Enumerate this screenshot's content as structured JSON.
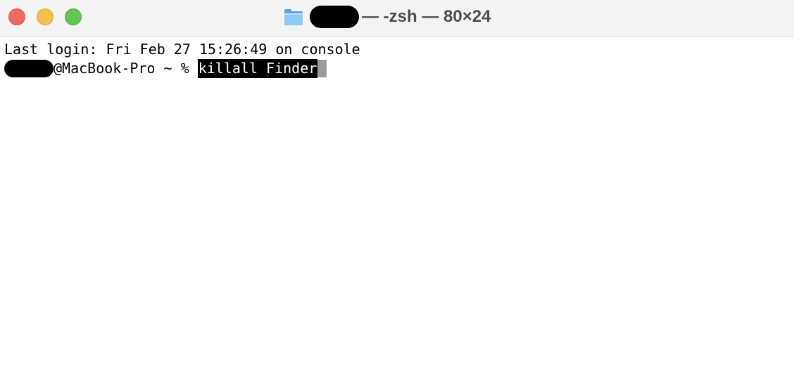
{
  "window": {
    "title": "— -zsh — 80×24",
    "controls": {
      "close": "close-button",
      "minimize": "minimize-button",
      "zoom": "zoom-button"
    },
    "folder_icon": "folder-icon"
  },
  "terminal": {
    "lines": [
      "Last login: Fri Feb 27 15:26:49 on console"
    ],
    "prompt": {
      "host_suffix": "@MacBook-Pro ~ % ",
      "command": "killall Finder"
    }
  },
  "colors": {
    "close": "#ed6a5e",
    "minimize": "#f5bf4f",
    "zoom": "#62c554",
    "titlebar": "#f5f4f4",
    "folder": "#6eb8ec",
    "selection_bg": "#000000",
    "cursor": "#9a9a9a"
  }
}
